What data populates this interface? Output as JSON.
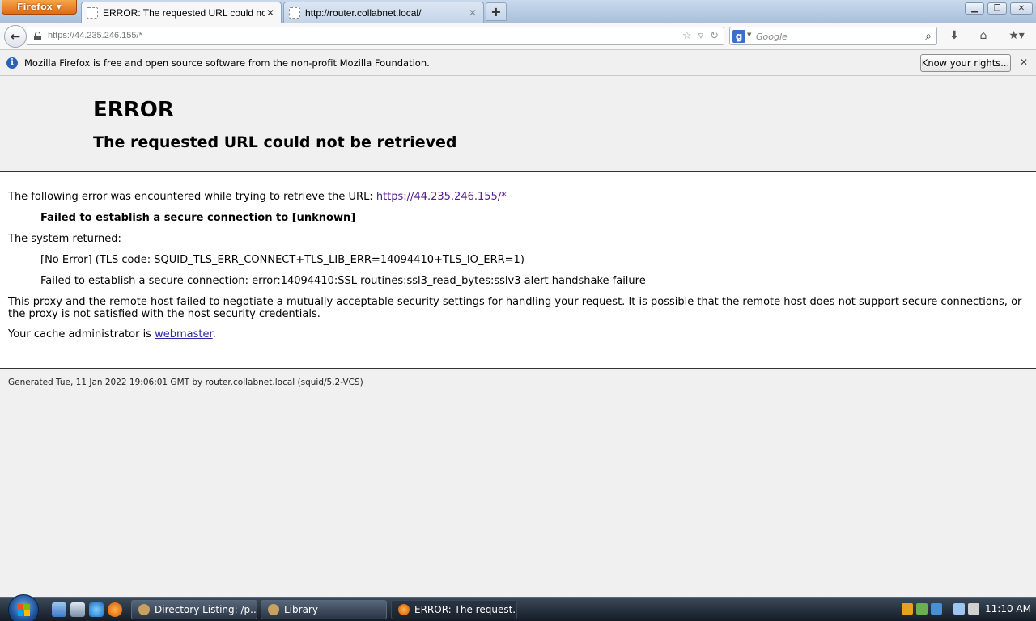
{
  "browser": {
    "app_button": "Firefox",
    "tabs": [
      {
        "title": "ERROR: The requested URL could not ...",
        "active": true
      },
      {
        "title": "http://router.collabnet.local/",
        "active": false
      }
    ],
    "new_tab": "+",
    "url_scheme": "https:",
    "url_rest": "//44.235.246.155/*",
    "search_placeholder": "Google"
  },
  "notification": {
    "text": "Mozilla Firefox is free and open source software from the non-profit Mozilla Foundation.",
    "button": "Know your rights..."
  },
  "page": {
    "heading": "ERROR",
    "subheading": "The requested URL could not be retrieved",
    "intro": "The following error was encountered while trying to retrieve the URL: ",
    "intro_link": "https://44.235.246.155/*",
    "failed": "Failed to establish a secure connection to [unknown]",
    "system_returned": "The system returned:",
    "no_error": "[No Error] (TLS code: SQUID_TLS_ERR_CONNECT+TLS_LIB_ERR=14094410+TLS_IO_ERR=1)",
    "secure_error": "Failed to establish a secure connection: error:14094410:SSL routines:ssl3_read_bytes:sslv3 alert handshake failure",
    "proxy_text": "This proxy and the remote host failed to negotiate a mutually acceptable security settings for handling your request. It is possible that the remote host does not support secure connections, or the proxy is not satisfied with the host security credentials.",
    "admin_prefix": "Your cache administrator is ",
    "admin_link": "webmaster",
    "admin_suffix": ".",
    "footer": "Generated Tue, 11 Jan 2022 19:06:01 GMT by router.collabnet.local (squid/5.2-VCS)"
  },
  "taskbar": {
    "items": [
      {
        "label": "Directory Listing: /p...",
        "active": false
      },
      {
        "label": "Library",
        "active": false
      },
      {
        "label": "ERROR: The request...",
        "active": true
      }
    ],
    "clock": "11:10 AM"
  },
  "colors": {
    "link": "#2a2aa8",
    "visited_link": "#551a8b",
    "firefox_orange": "#e06b12",
    "taskbar": "#141c26"
  }
}
